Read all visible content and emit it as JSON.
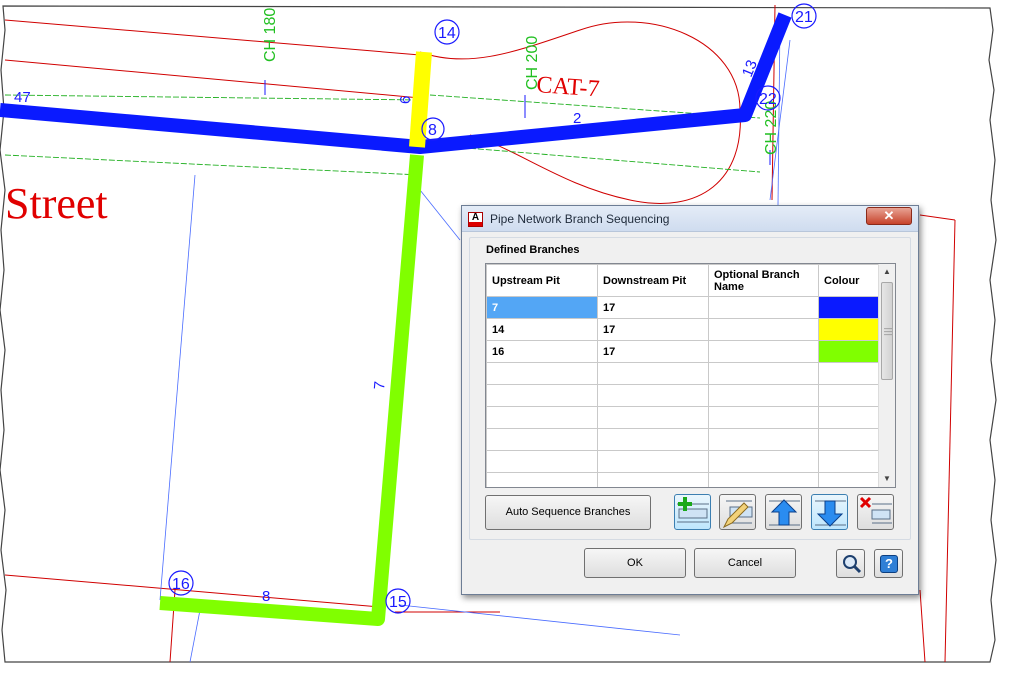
{
  "drawing": {
    "street_label": "Street",
    "cat_label": "CAT-7",
    "chainage_labels": [
      "CH 180",
      "CH 200",
      "CH 220"
    ],
    "pits": [
      "14",
      "21",
      "22",
      "8",
      "16",
      "15"
    ],
    "pipes": [
      "47",
      "6",
      "2",
      "13",
      "7",
      "8"
    ],
    "colors": {
      "blue_branch": "#0a1aff",
      "yellow_branch": "#ffff00",
      "green_branch": "#80ff00"
    }
  },
  "dialog": {
    "app_icon_letter": "A",
    "title": "Pipe Network Branch Sequencing",
    "close_label": "✕",
    "group_label": "Defined Branches",
    "columns": [
      "Upstream Pit",
      "Downstream Pit",
      "Optional Branch Name",
      "Colour"
    ],
    "rows": [
      {
        "upstream": "7",
        "downstream": "17",
        "name": "",
        "colour": "#0a1aff"
      },
      {
        "upstream": "14",
        "downstream": "17",
        "name": "",
        "colour": "#ffff00"
      },
      {
        "upstream": "16",
        "downstream": "17",
        "name": "",
        "colour": "#80ff00"
      }
    ],
    "auto_sequence_label": "Auto Sequence Branches",
    "tool_icons": [
      "add-branch-icon",
      "edit-branch-icon",
      "move-up-icon",
      "move-down-icon",
      "delete-branch-icon"
    ],
    "ok_label": "OK",
    "cancel_label": "Cancel",
    "help_icons": [
      "zoom-icon",
      "help-icon"
    ],
    "help_label": "?"
  }
}
